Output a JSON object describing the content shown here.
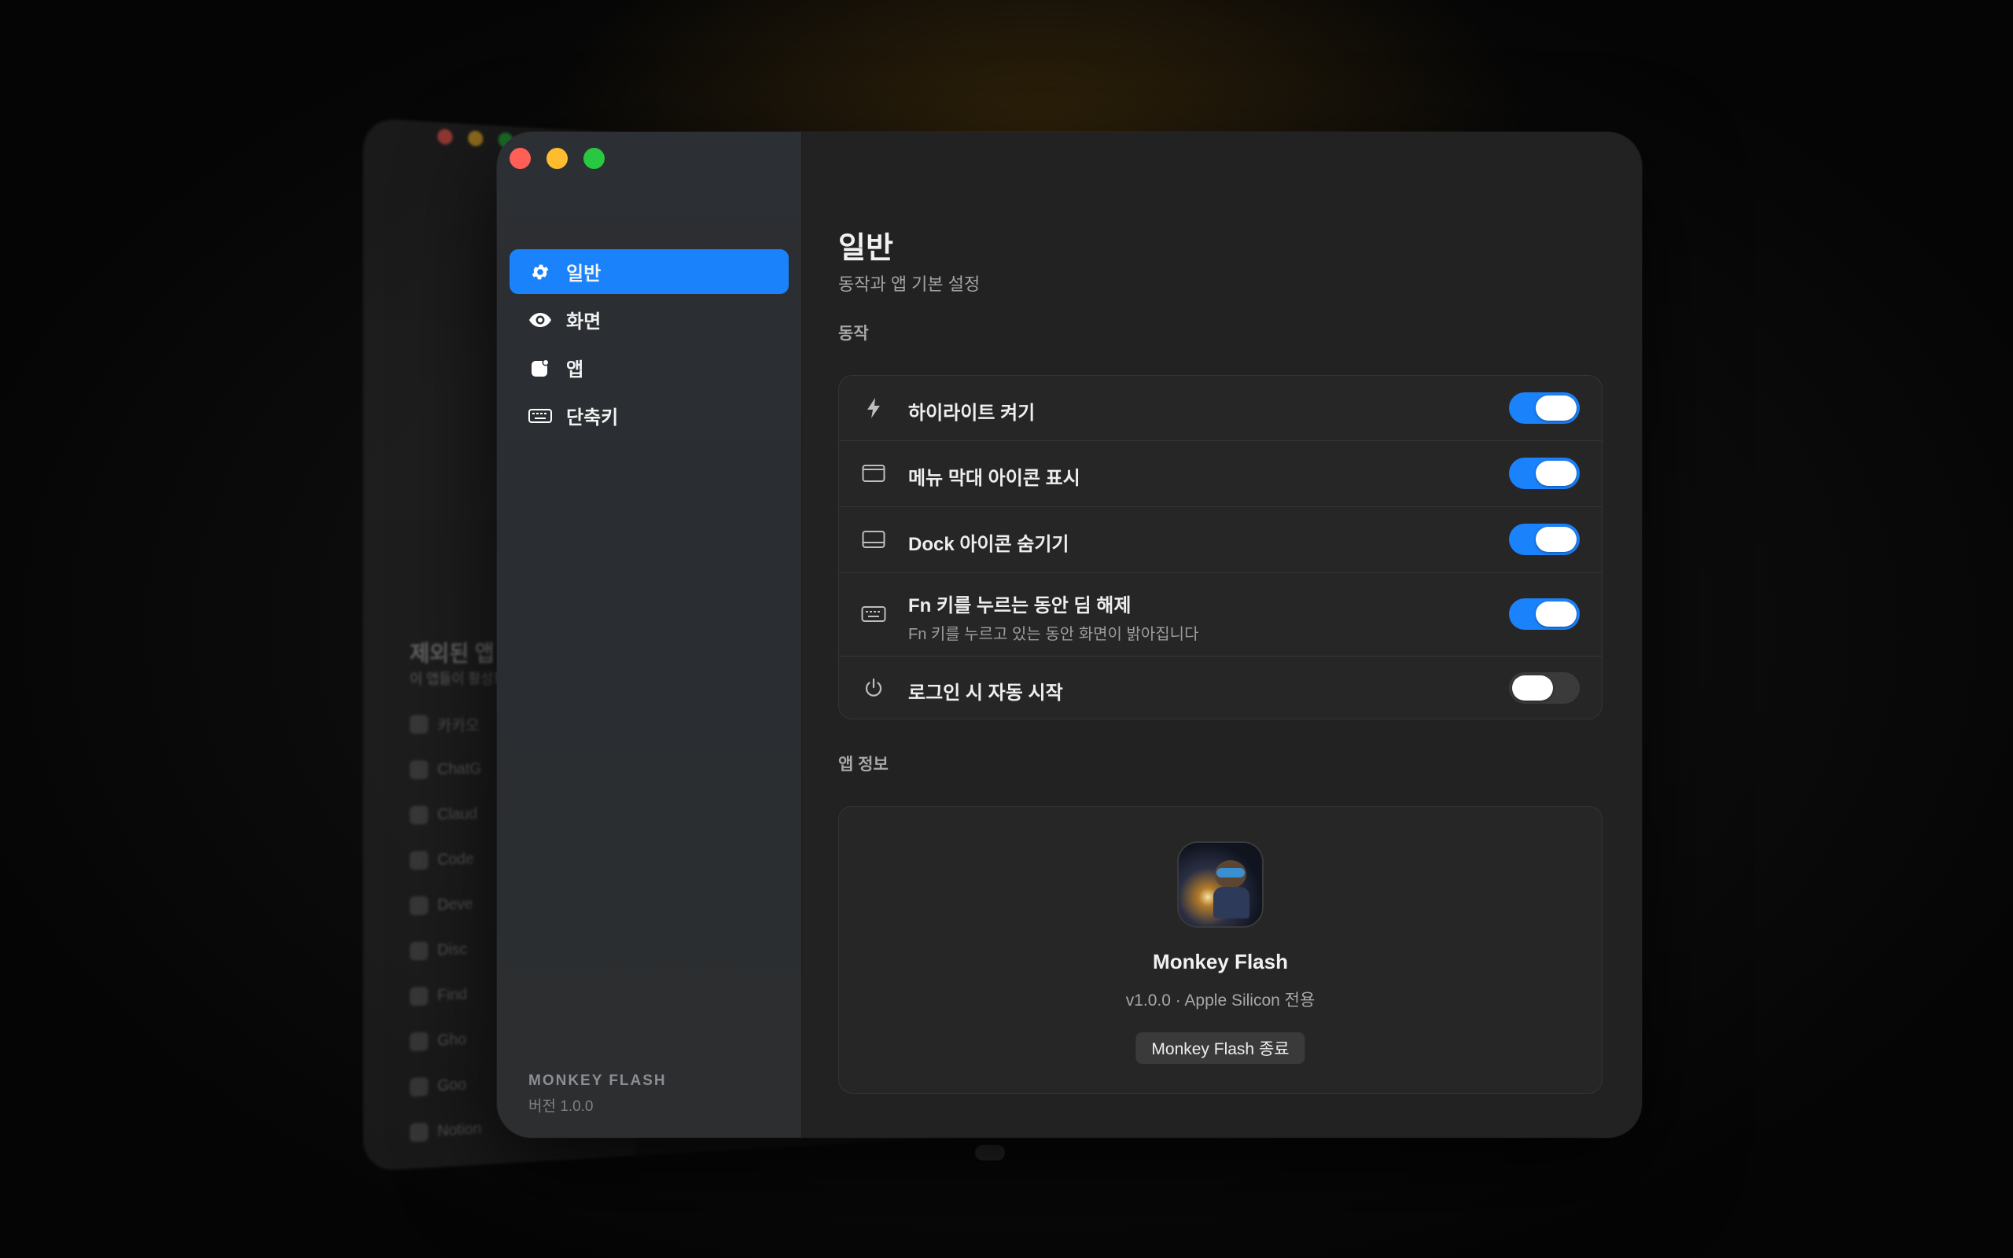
{
  "window": {
    "traffic_lights": [
      "close",
      "minimize",
      "zoom"
    ]
  },
  "sidebar": {
    "items": [
      {
        "label": "일반",
        "icon": "gear-icon",
        "active": true
      },
      {
        "label": "화면",
        "icon": "eye-icon",
        "active": false
      },
      {
        "label": "앱",
        "icon": "app-icon",
        "active": false
      },
      {
        "label": "단축키",
        "icon": "keyboard-icon",
        "active": false
      }
    ],
    "brand": "MONKEY FLASH",
    "version": "버전 1.0.0"
  },
  "main": {
    "title": "일반",
    "subtitle": "동작과 앱 기본 설정",
    "section_behavior": "동작",
    "settings": [
      {
        "label": "하이라이트 켜기",
        "description": "",
        "icon": "bolt-icon",
        "enabled": true
      },
      {
        "label": "메뉴 막대 아이콘 표시",
        "description": "",
        "icon": "menubar-icon",
        "enabled": true
      },
      {
        "label": "Dock 아이콘 숨기기",
        "description": "",
        "icon": "dock-icon",
        "enabled": true
      },
      {
        "label": "Fn 키를 누르는 동안 딤 해제",
        "description": "Fn 키를 누르고 있는 동안 화면이 밝아집니다",
        "icon": "keyboard-icon",
        "enabled": true
      },
      {
        "label": "로그인 시 자동 시작",
        "description": "",
        "icon": "power-icon",
        "enabled": false
      }
    ],
    "section_info": "앱 정보",
    "app_info": {
      "name": "Monkey Flash",
      "version_line": "v1.0.0 · Apple Silicon 전용",
      "quit_label": "Monkey Flash 종료"
    }
  },
  "background_window": {
    "section_title": "제외된 앱",
    "section_subtitle": "이 앱들이 활성화 되",
    "apps": [
      "카카오",
      "ChatG",
      "Claud",
      "Code",
      "Deve",
      "Disc",
      "Find",
      "Gho",
      "Goo",
      "Notion"
    ]
  },
  "colors": {
    "accent": "#1a82fb",
    "close": "#ff5f57",
    "minimize": "#febc2e",
    "zoom": "#28c840"
  }
}
